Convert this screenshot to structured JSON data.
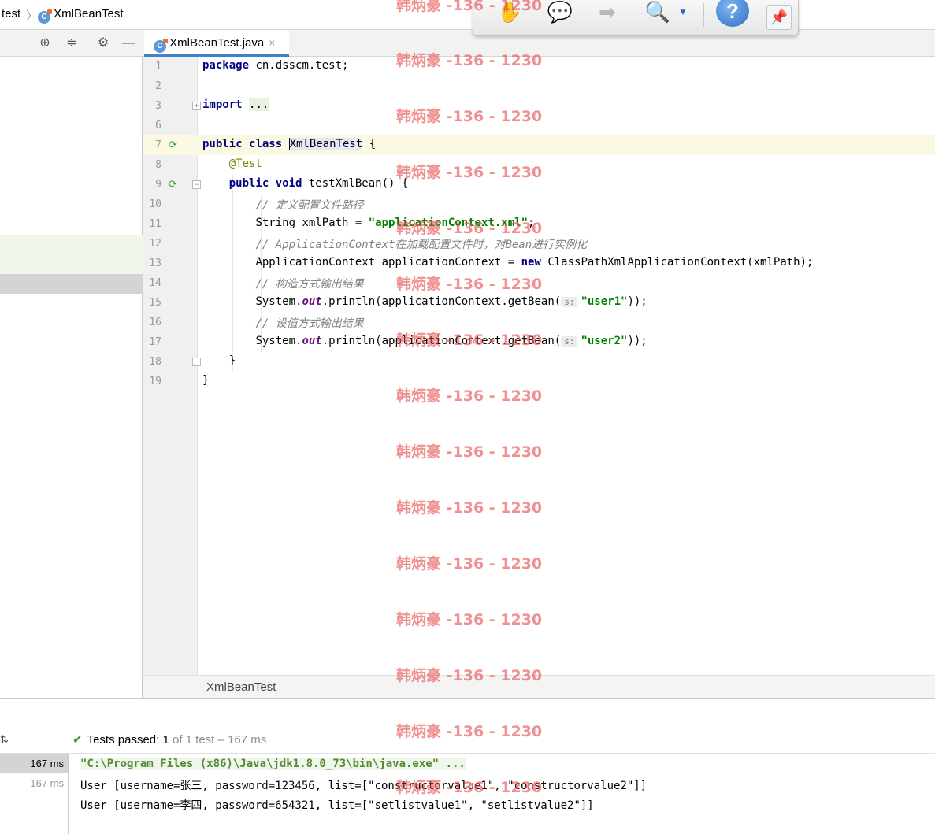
{
  "breadcrumb": {
    "parent": "test",
    "current": "XmlBeanTest"
  },
  "editor_tab": {
    "label": "XmlBeanTest.java",
    "close": "×"
  },
  "code_lines": [
    {
      "num": "1"
    },
    {
      "num": "2"
    },
    {
      "num": "3"
    },
    {
      "num": "6"
    },
    {
      "num": "7"
    },
    {
      "num": "8"
    },
    {
      "num": "9"
    },
    {
      "num": "10"
    },
    {
      "num": "11"
    },
    {
      "num": "12"
    },
    {
      "num": "13"
    },
    {
      "num": "14"
    },
    {
      "num": "15"
    },
    {
      "num": "16"
    },
    {
      "num": "17"
    },
    {
      "num": "18"
    },
    {
      "num": "19"
    }
  ],
  "code": {
    "l1_kw": "package",
    "l1_rest": " cn.dsscm.test;",
    "l3_kw": "import",
    "l3_collapsed": "...",
    "l7_kw": "public class ",
    "l7_cls": "XmlBeanTest",
    "l7_rest": " {",
    "l8_ann": "@Test",
    "l9_kw": "public void ",
    "l9_rest": "testXmlBean() {",
    "l10_cmt": "// 定义配置文件路径",
    "l11_pre": "String xmlPath = ",
    "l11_str": "\"applicationContext.xml\"",
    "l11_post": ";",
    "l12_cmt": "// ApplicationContext在加载配置文件时，对Bean进行实例化",
    "l13_pre": "ApplicationContext applicationContext = ",
    "l13_kw": "new",
    "l13_post": " ClassPathXmlApplicationContext(xmlPath);",
    "l14_cmt": "// 构造方式输出结果",
    "l15_pre": "System.",
    "l15_fld": "out",
    "l15_mid": ".println(applicationContext.getBean(",
    "l15_hint": "s:",
    "l15_str": "\"user1\"",
    "l15_post": "));",
    "l16_cmt": "// 设值方式输出结果",
    "l17_pre": "System.",
    "l17_fld": "out",
    "l17_mid": ".println(applicationContext.getBean(",
    "l17_hint": "s:",
    "l17_str": "\"user2\"",
    "l17_post": "));",
    "l18": "}",
    "l19": "}"
  },
  "editor_breadcrumb": "XmlBeanTest",
  "run": {
    "status_prefix": "Tests passed: ",
    "status_count": "1",
    "status_suffix": " of 1 test – 167 ms",
    "times": [
      "167 ms",
      "167 ms"
    ],
    "console": [
      "\"C:\\Program Files (x86)\\Java\\jdk1.8.0_73\\bin\\java.exe\" ...",
      "User [username=张三, password=123456, list=[\"constructorvalue1\", \"constructorvalue2\"]]",
      "User [username=李四, password=654321, list=[\"setlistvalue1\", \"setlistvalue2\"]]"
    ]
  },
  "float_toolbar": {
    "help": "?"
  },
  "watermark": "韩炳豪 -136 - 1230",
  "colors": {
    "accent": "#4083c9",
    "keyword": "#000080",
    "string": "#008000",
    "comment": "#808080",
    "pass": "#3b9b3b"
  }
}
